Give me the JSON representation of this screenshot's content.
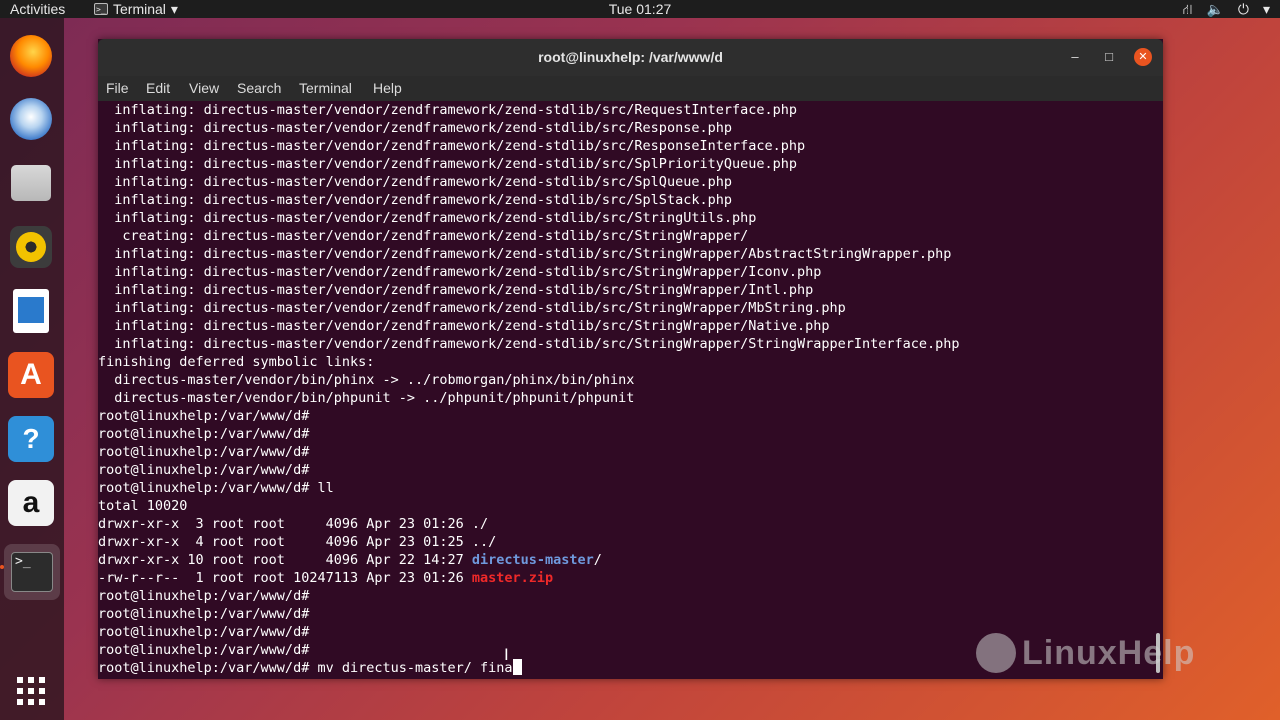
{
  "topbar": {
    "activities": "Activities",
    "app_name": "Terminal",
    "app_menu_arrow": "▾",
    "clock": "Tue 01:27",
    "status_icons": [
      "network-icon",
      "volume-icon",
      "power-icon"
    ]
  },
  "dock": {
    "items": [
      "firefox-icon",
      "thunderbird-icon",
      "files-icon",
      "rhythmbox-icon",
      "libreoffice-writer-icon",
      "software-center-icon",
      "help-icon",
      "amazon-icon",
      "terminal-icon",
      "show-applications-icon"
    ]
  },
  "window": {
    "title": "root@linuxhelp: /var/www/d",
    "menu": [
      "File",
      "Edit",
      "View",
      "Search",
      "Terminal",
      "Help"
    ]
  },
  "terminal": {
    "lines": [
      "  inflating: directus-master/vendor/zendframework/zend-stdlib/src/RequestInterface.php",
      "  inflating: directus-master/vendor/zendframework/zend-stdlib/src/Response.php",
      "  inflating: directus-master/vendor/zendframework/zend-stdlib/src/ResponseInterface.php",
      "  inflating: directus-master/vendor/zendframework/zend-stdlib/src/SplPriorityQueue.php",
      "  inflating: directus-master/vendor/zendframework/zend-stdlib/src/SplQueue.php",
      "  inflating: directus-master/vendor/zendframework/zend-stdlib/src/SplStack.php",
      "  inflating: directus-master/vendor/zendframework/zend-stdlib/src/StringUtils.php",
      "   creating: directus-master/vendor/zendframework/zend-stdlib/src/StringWrapper/",
      "  inflating: directus-master/vendor/zendframework/zend-stdlib/src/StringWrapper/AbstractStringWrapper.php",
      "  inflating: directus-master/vendor/zendframework/zend-stdlib/src/StringWrapper/Iconv.php",
      "  inflating: directus-master/vendor/zendframework/zend-stdlib/src/StringWrapper/Intl.php",
      "  inflating: directus-master/vendor/zendframework/zend-stdlib/src/StringWrapper/MbString.php",
      "  inflating: directus-master/vendor/zendframework/zend-stdlib/src/StringWrapper/Native.php",
      "  inflating: directus-master/vendor/zendframework/zend-stdlib/src/StringWrapper/StringWrapperInterface.php",
      "finishing deferred symbolic links:",
      "  directus-master/vendor/bin/phinx -> ../robmorgan/phinx/bin/phinx",
      "  directus-master/vendor/bin/phpunit -> ../phpunit/phpunit/phpunit",
      "root@linuxhelp:/var/www/d#",
      "root@linuxhelp:/var/www/d#",
      "root@linuxhelp:/var/www/d#",
      "root@linuxhelp:/var/www/d#",
      "root@linuxhelp:/var/www/d# ll",
      "total 10020"
    ],
    "listing": [
      {
        "prefix": "drwxr-xr-x  3 root root     4096 Apr 23 01:26 ",
        "name": "./",
        "kind": "plain"
      },
      {
        "prefix": "drwxr-xr-x  4 root root     4096 Apr 23 01:25 ",
        "name": "../",
        "kind": "plain"
      },
      {
        "prefix": "drwxr-xr-x 10 root root     4096 Apr 22 14:27 ",
        "name": "directus-master",
        "suffix": "/",
        "kind": "dir"
      },
      {
        "prefix": "-rw-r--r--  1 root root 10247113 Apr 23 01:26 ",
        "name": "master.zip",
        "kind": "zip"
      }
    ],
    "after_lines": [
      "root@linuxhelp:/var/www/d#",
      "root@linuxhelp:/var/www/d#",
      "root@linuxhelp:/var/www/d#",
      "root@linuxhelp:/var/www/d#"
    ],
    "current_prompt": "root@linuxhelp:/var/www/d# ",
    "current_input": "mv directus-master/ fina"
  },
  "watermark": {
    "text": "LinuxHelp"
  }
}
